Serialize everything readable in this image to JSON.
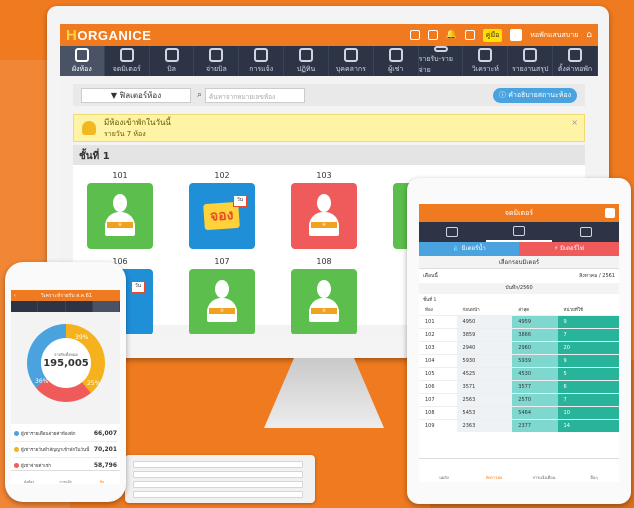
{
  "desktop": {
    "logo": "ORGANICE",
    "top_icons": [
      "bed-icon",
      "card-icon",
      "bell-icon",
      "door-icon",
      "help-icon"
    ],
    "help_label": "คู่มือ",
    "user_name": "หอพักแสนสบาย",
    "nav": [
      {
        "label": "ผังห้อง",
        "icon": "grid-icon"
      },
      {
        "label": "จดมิเตอร์",
        "icon": "meter-icon"
      },
      {
        "label": "บิล",
        "icon": "bill-icon"
      },
      {
        "label": "จ่ายบิล",
        "icon": "cash-icon"
      },
      {
        "label": "การแจ้ง",
        "icon": "megaphone-icon"
      },
      {
        "label": "ปฏิทิน",
        "icon": "calendar-icon"
      },
      {
        "label": "บุคคลากร",
        "icon": "staff-icon"
      },
      {
        "label": "ผู้เช่า",
        "icon": "tenant-icon"
      },
      {
        "label": "รายรับ-รายจ่าย",
        "icon": "wallet-icon"
      },
      {
        "label": "วิเคราะห์",
        "icon": "chart-icon"
      },
      {
        "label": "รายงานสรุป",
        "icon": "report-icon"
      },
      {
        "label": "ตั้งค่าหอพัก",
        "icon": "gear-icon"
      }
    ],
    "filter_label": "▼ ฟิลเตอร์ห้อง",
    "search_placeholder": "ค้นหาจากหมายเลขห้อง",
    "info_label": "คำอธิบายสถานะห้อง",
    "alert_title": "มีห้องเข้าพักในวันนี้",
    "alert_sub": "รายวัน 7 ห้อง",
    "floor_title": "ชั้นที่ 1",
    "rooms": [
      {
        "num": "101",
        "status": "occupied"
      },
      {
        "num": "102",
        "status": "booked"
      },
      {
        "num": "103",
        "status": "overdue"
      },
      {
        "num": "106",
        "status": "booked"
      },
      {
        "num": "107",
        "status": "occupied"
      },
      {
        "num": "108",
        "status": "occupied"
      }
    ],
    "book_label": "จอง",
    "cal_label": "วัน"
  },
  "phone": {
    "title": "วิเคราะห์รายรับ ส.ค.61",
    "center_label": "รายรับทั้งหมด",
    "center_value": "195,005",
    "pct_yellow": "39%",
    "pct_red": "25%",
    "pct_blue": "36%",
    "legend": [
      {
        "label": "ผู้เช่ารายเดือนจ่ายค่าห้องพัก",
        "value": "66,007",
        "color": "#4aa3df"
      },
      {
        "label": "ผู้เช่ารายวันทำสัญญาเข้าพักในวันนี้",
        "value": "70,201",
        "color": "#f5b21d"
      },
      {
        "label": "ผู้เช่าจ่ายค่าเช่า",
        "value": "58,796",
        "color": "#ef5b5b"
      }
    ],
    "nav": [
      "ผังห้อง",
      "การแจ้ง",
      "บิล"
    ]
  },
  "tablet": {
    "title": "จดมิเตอร์",
    "water_label": "มิเตอร์น้ำ",
    "elec_label": "มิเตอร์ไฟ",
    "select_title": "เลือกรอบมิเตอร์",
    "month_label": "เดือนนี้",
    "month_value": "สิงหาคม / 2561",
    "save_label": "บันทึก/2560",
    "floor_label": "ชั้นที่ 1",
    "headers": [
      "ห้อง",
      "ก่อนหน้า",
      "ล่าสุด",
      "หน่วยที่ใช้"
    ],
    "rows": [
      [
        "101",
        "4950",
        "4959",
        "9"
      ],
      [
        "102",
        "3859",
        "3866",
        "7"
      ],
      [
        "103",
        "2940",
        "2960",
        "20"
      ],
      [
        "104",
        "5930",
        "5939",
        "9"
      ],
      [
        "105",
        "4525",
        "4530",
        "5"
      ],
      [
        "106",
        "3571",
        "3577",
        "6"
      ],
      [
        "107",
        "2563",
        "2570",
        "7"
      ],
      [
        "108",
        "5453",
        "5464",
        "10"
      ],
      [
        "109",
        "2363",
        "2377",
        "14"
      ]
    ],
    "nav": [
      "แผลัง",
      "จัดการหอ",
      "การแจ้งเตือน",
      "อื่นๆ"
    ]
  },
  "colors": {
    "accent": "#f07a1f",
    "nav": "#2c3446",
    "green": "#5cbe4c",
    "blue": "#1f8fd8",
    "red": "#ef5b5b"
  }
}
